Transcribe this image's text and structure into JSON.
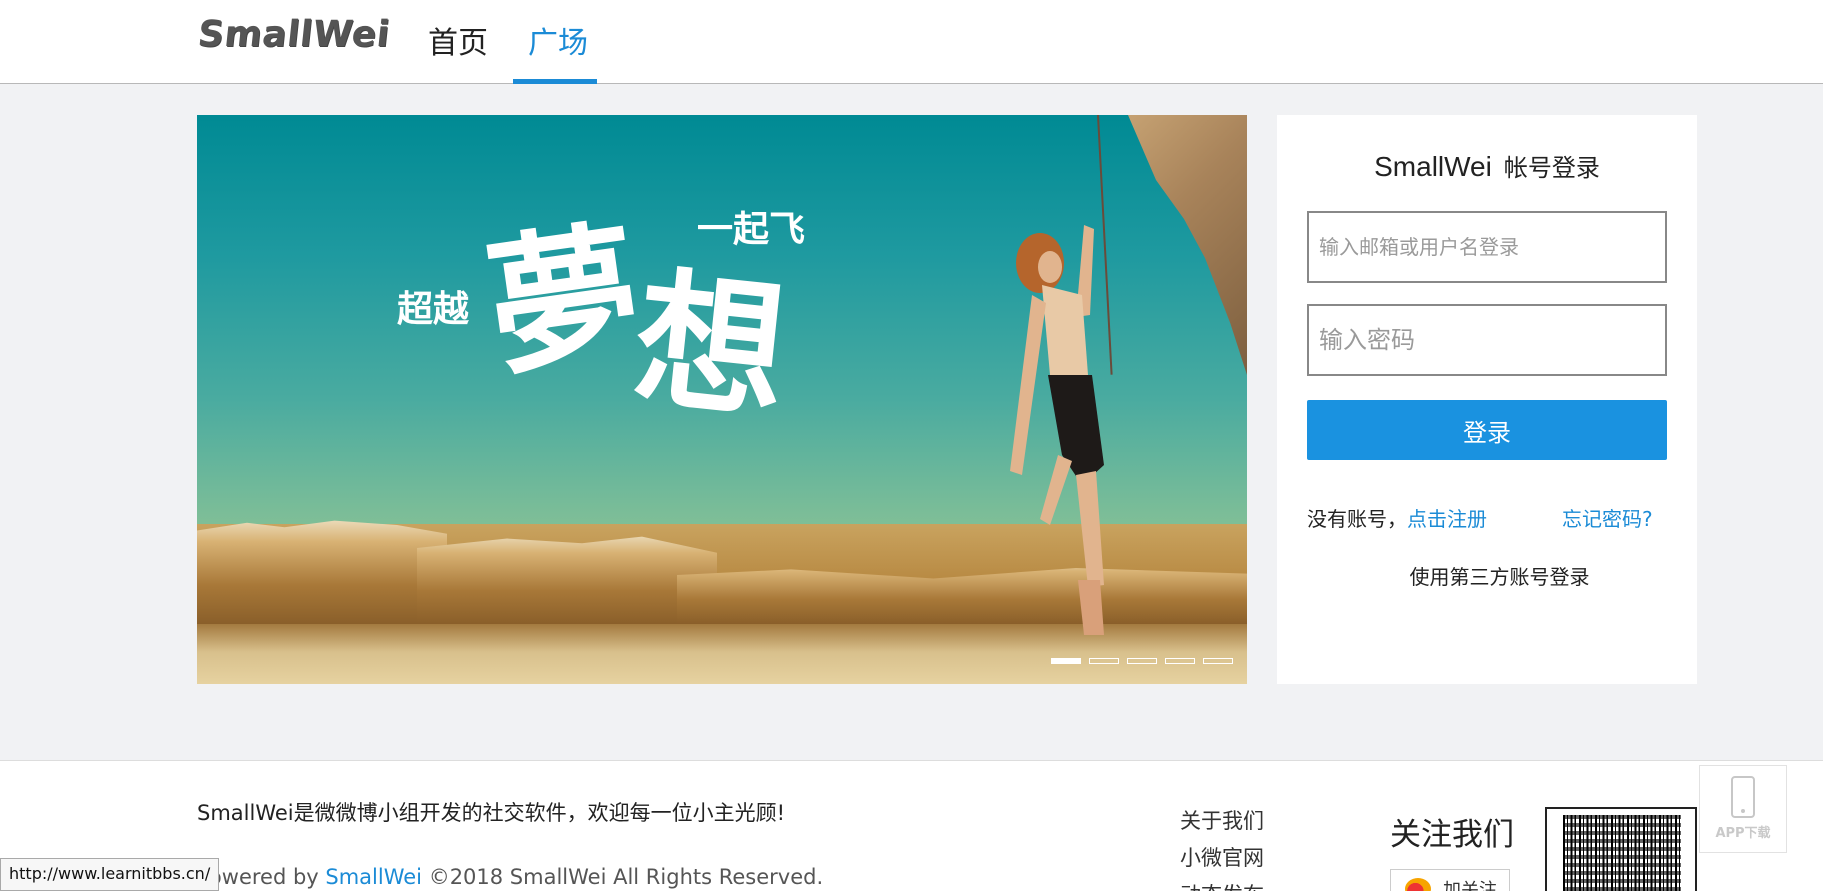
{
  "header": {
    "logo": "SmallWei",
    "nav": [
      {
        "label": "首页"
      },
      {
        "label": "广场",
        "active": true
      }
    ],
    "accent_color": "#1b8bd6"
  },
  "banner": {
    "slogan_left": "超越",
    "slogan_big_1": "夢",
    "slogan_big_2": "想",
    "slogan_right": "一起飞",
    "slide_count": 5,
    "active_slide": 1
  },
  "login": {
    "brand": "SmallWei",
    "title": "帐号登录",
    "username_placeholder": "输入邮箱或用户名登录",
    "password_placeholder": "输入密码",
    "submit_label": "登录",
    "no_account_text": "没有账号，",
    "register_link": "点击注册",
    "forgot_link": "忘记密码?",
    "third_party_text": "使用第三方账号登录",
    "button_color": "#1a92e0"
  },
  "footer": {
    "description": "SmallWei是微微博小组开发的社交软件，欢迎每一位小主光顾!",
    "copyright_prefix": "Powered by ",
    "copyright_brand": "SmallWei",
    "copyright_suffix": " ©2018 SmallWei All Rights Reserved.",
    "links": [
      "关于我们",
      "小微官网",
      "动态发布"
    ],
    "follow_title": "关注我们",
    "follow_button": "加关注",
    "app_download": "APP下载"
  },
  "status_bar": {
    "url": "http://www.learnitbbs.cn/"
  }
}
